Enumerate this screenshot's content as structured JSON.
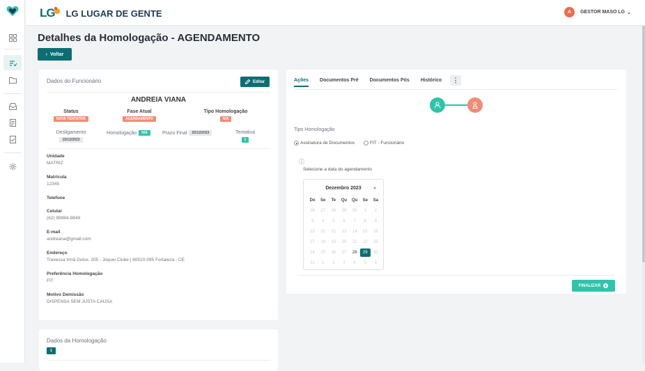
{
  "app": {
    "brand_short": "LG",
    "brand_name": "LG LUGAR DE GENTE",
    "user_initial": "A",
    "user_name": "GESTOR MASO LG",
    "accent": "#0b6e73",
    "secondary": "#2ec4a9",
    "warn": "#f28b74"
  },
  "rail": {
    "icons": [
      "dashboard-icon",
      "checklist-icon",
      "folder-icon",
      "inbox-icon",
      "document-icon",
      "document-check-icon",
      "settings-icon"
    ]
  },
  "page": {
    "title": "Detalhes da Homologação - AGENDAMENTO",
    "back_label": "Voltar"
  },
  "funcionario": {
    "header": "Dados do Funcionário",
    "edit_label": "Editar",
    "name": "ANDREIA VIANA",
    "status_label": "Status",
    "status_value": "NOVA TENTATIVA",
    "fase_label": "Fase Atual",
    "fase_value": "AGENDAMENTO",
    "tipo_label": "Tipo Homologação",
    "tipo_value": "N/A",
    "deslig_label": "Desligamento",
    "deslig_value": "15/12/2023",
    "homolog_label": "Homologação",
    "homolog_value": "N/A",
    "prazo_label": "Prazo Final",
    "prazo_value": "25/12/2023",
    "tentativa_label": "Tentativa",
    "tentativa_value": "1",
    "fields": [
      {
        "k": "Unidade",
        "v": "MATRIZ"
      },
      {
        "k": "Matrícula",
        "v": "12345"
      },
      {
        "k": "Telefone",
        "v": ""
      },
      {
        "k": "Celular",
        "v": "(62) 99984-9849"
      },
      {
        "k": "E-mail",
        "v": "andreana@gmail.com"
      },
      {
        "k": "Endereço",
        "v": "Travessa Irmã Dulce, 205 - Jóquei Clube | 60510-095 Fortaleza - CE"
      },
      {
        "k": "Preferência Homologação",
        "v": "FIT"
      },
      {
        "k": "Motivo Demissão",
        "v": "DISPENSA SEM JUSTA CAUSA"
      }
    ]
  },
  "homologacao": {
    "header": "Dados da Homologação",
    "badge": "1"
  },
  "acoes": {
    "tabs": [
      "Ações",
      "Documentos Pré",
      "Documentos Pós",
      "Histórico"
    ],
    "kebab": "⋮",
    "tipo_label": "Tipo Homologação",
    "radio1": "Assinatura de Documentos",
    "radio2": "FIT - Funcionário",
    "info_icon": "ⓘ",
    "select_label": "Selecione a data do agendamento",
    "calendar": {
      "month": "Dezembro 2023",
      "next": "»",
      "days": [
        "Do",
        "Se",
        "Te",
        "Qu",
        "Qu",
        "Se",
        "Sa"
      ],
      "cells": [
        "26",
        "27",
        "28",
        "29",
        "30",
        "1",
        "2",
        "3",
        "4",
        "5",
        "6",
        "7",
        "8",
        "9",
        "10",
        "11",
        "12",
        "13",
        "14",
        "15",
        "16",
        "17",
        "18",
        "19",
        "20",
        "21",
        "22",
        "23",
        "24",
        "25",
        "26",
        "27",
        "28",
        "29",
        "30",
        "31",
        "1",
        "2",
        "3",
        "4",
        "5",
        "6"
      ],
      "current": "28",
      "selected": "29"
    },
    "finalizar_label": "FINALIZAR"
  }
}
